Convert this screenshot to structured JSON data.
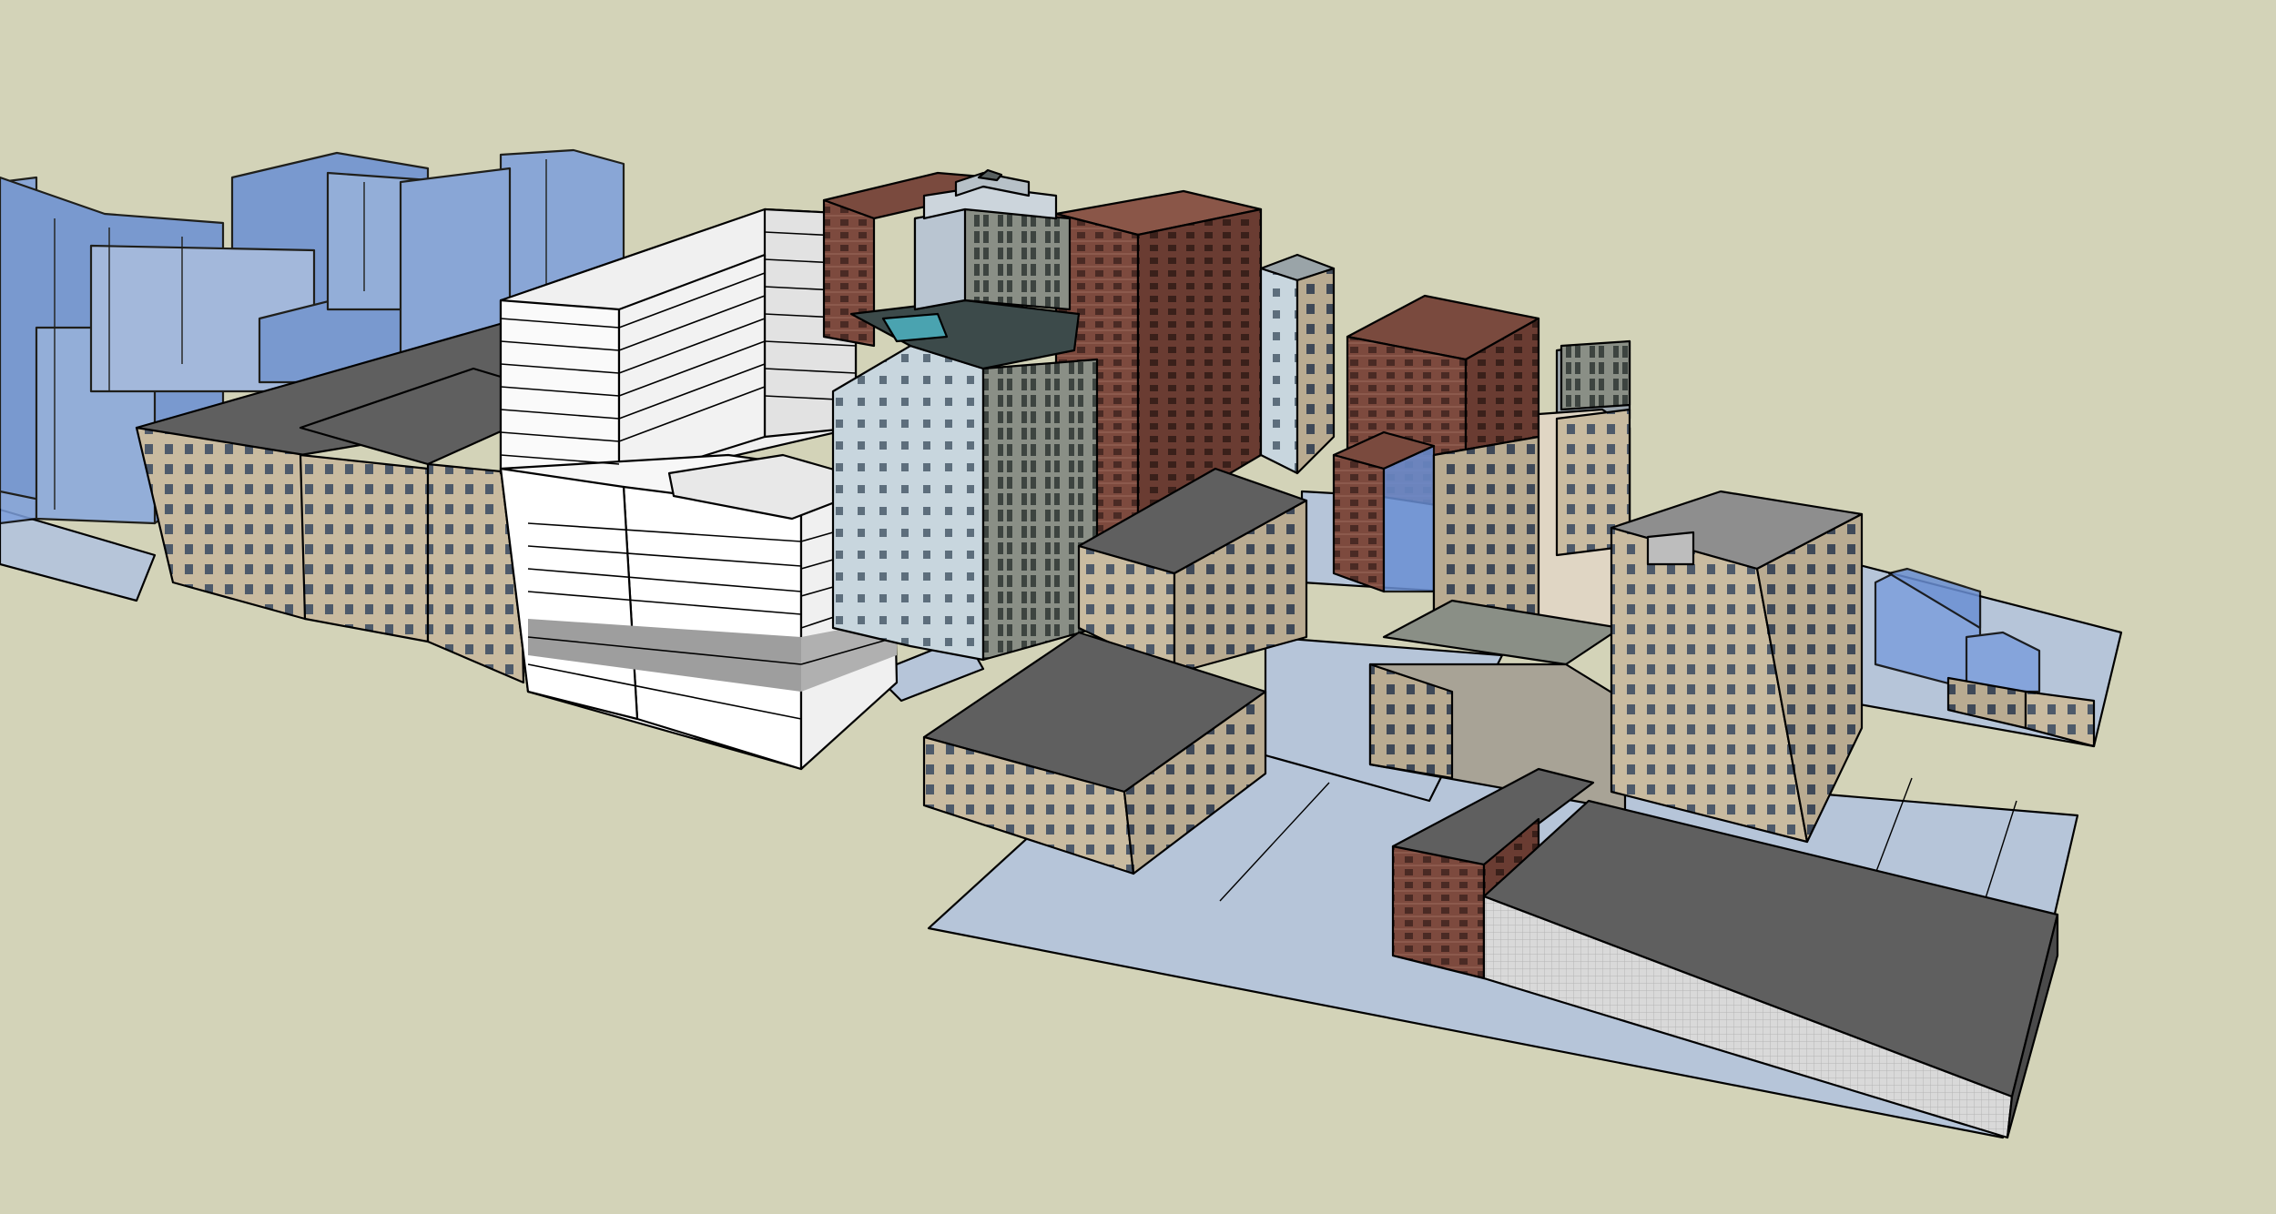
{
  "scene": {
    "background": "#d3d3b8",
    "ground_color": "#d3d3b8",
    "lot_color": "#b6c5d9",
    "glass_color": "#6a8fd4",
    "roof_color": "#5f5f5f",
    "stone_color": "#c9bba0",
    "brick_color": "#7a4a3e",
    "white_color": "#f6f6f6"
  },
  "icons": {
    "building": "building-icon"
  }
}
